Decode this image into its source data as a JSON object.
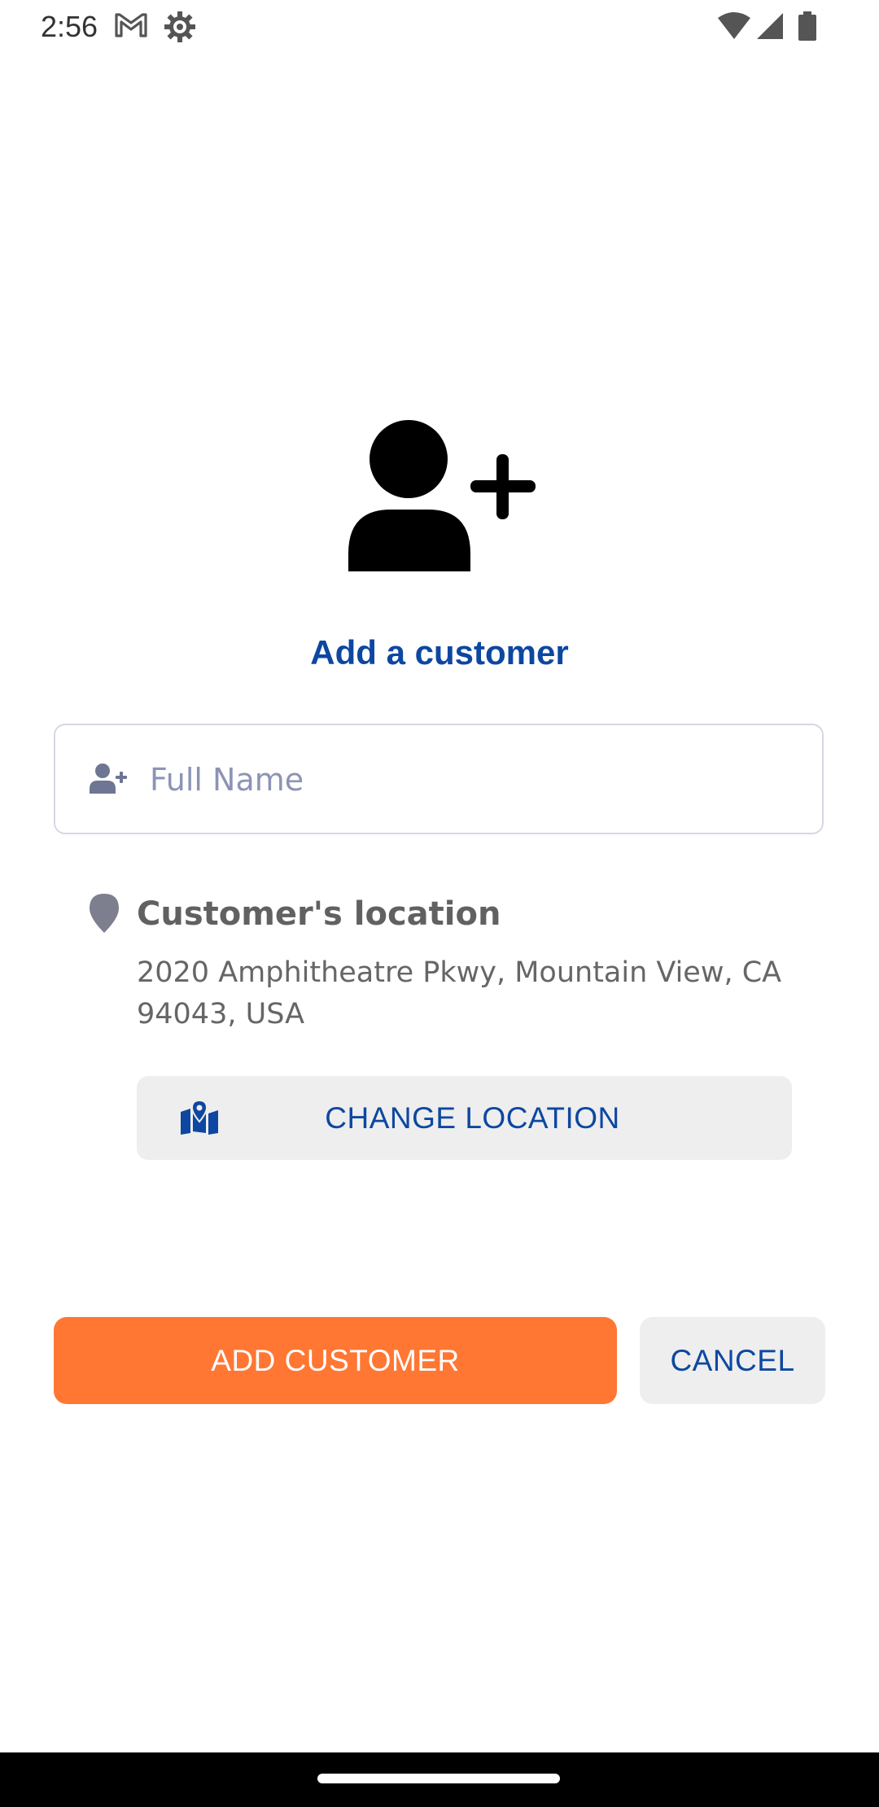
{
  "status_bar": {
    "time": "2:56",
    "icons": [
      "gmail-icon",
      "gear-icon",
      "wifi-icon",
      "signal-icon",
      "battery-icon"
    ]
  },
  "header": {
    "icon": "add-person-icon",
    "title": "Add a customer"
  },
  "form": {
    "name_field": {
      "icon": "add-user-icon",
      "placeholder": "Full Name",
      "value": ""
    },
    "location": {
      "icon": "location-pin-icon",
      "heading": "Customer's location",
      "address": "2020 Amphitheatre Pkwy, Mountain View, CA 94043, USA",
      "change_button": {
        "icon": "map-marker-icon",
        "label": "CHANGE LOCATION"
      }
    }
  },
  "actions": {
    "add_label": "ADD CUSTOMER",
    "cancel_label": "CANCEL"
  },
  "colors": {
    "primary_blue": "#0d47a1",
    "accent_orange": "#ff7733",
    "button_grey": "#eeeeee",
    "placeholder": "#8c94b5"
  }
}
